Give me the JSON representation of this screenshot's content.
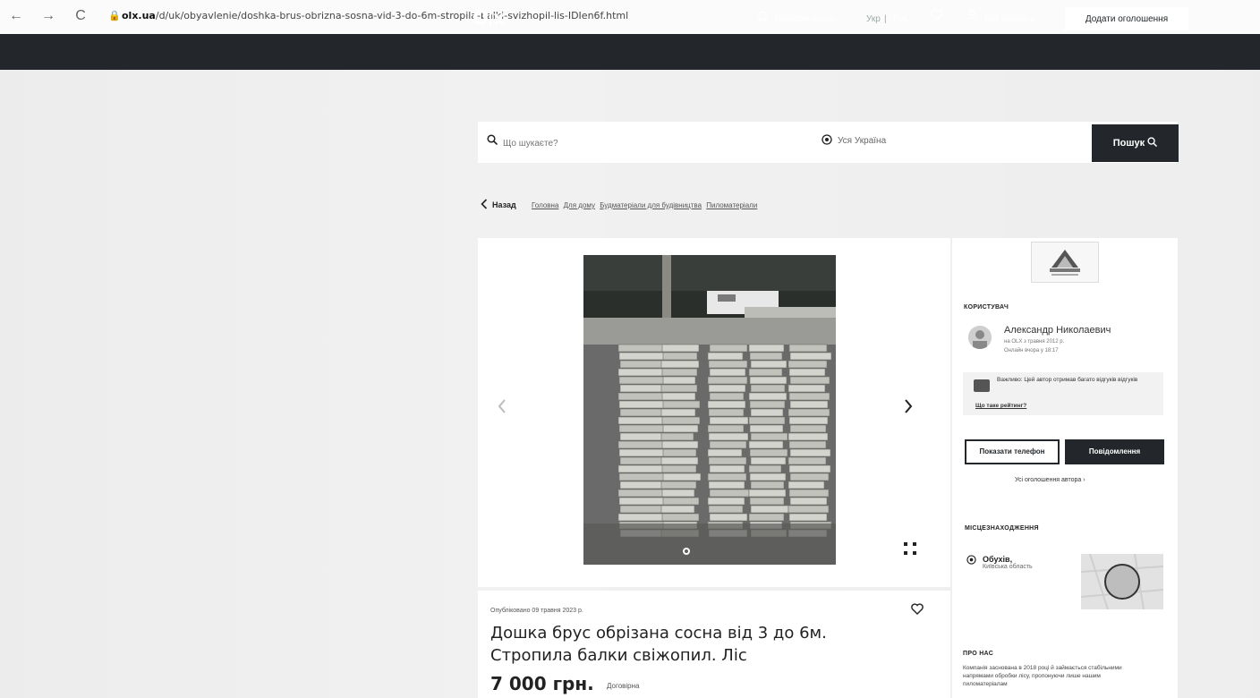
{
  "browser": {
    "back_glyph": "←",
    "forward_glyph": "→",
    "reload_glyph": "C",
    "url_domain": "olx.ua",
    "url_path": "/d/uk/obyavlenie/doshka-brus-obrizna-sosna-vid-3-do-6m-stropila-balki-svizhopil-lis-IDIen6f.html"
  },
  "header": {
    "logo": "olx",
    "messages_label": "Повідомлення",
    "lang_ua": "Укр",
    "lang_ru": "Рус",
    "profile_label": "Мій профіль",
    "add_ad_label": "Додати оголошення"
  },
  "search": {
    "placeholder": "Що шукаєте?",
    "location": "Уся Україна",
    "button_label": "Пошук"
  },
  "breadcrumb": {
    "back_label": "Назад",
    "items": [
      "Головна",
      "Для дому",
      "Будматеріали для будівництва",
      "Пиломатеріали"
    ]
  },
  "listing": {
    "posted": "Опубліковано 09 травня 2023 р.",
    "title": "Дошка брус обрізана сосна від 3 до 6м. Стропила балки свіжопил. Ліс",
    "price": "7 000 грн.",
    "negotiable": "Договірна"
  },
  "seller": {
    "section_label": "КОРИСТУВАЧ",
    "name": "Александр Николаевич",
    "since": "на OLX з травня 2012 р.",
    "online": "Онлайн вчора у 18:17",
    "warning_text": "Важливо: Цей автор отримав багато відгуків відгуків",
    "warning_link": "Що таке рейтинг?",
    "show_phone_label": "Показати телефон",
    "message_label": "Повідомлення",
    "all_ads_label": "Усі оголошення автора"
  },
  "location": {
    "section_label": "МІСЦЕЗНАХОДЖЕННЯ",
    "city": "Обухів,",
    "region": "Київська область"
  },
  "about": {
    "section_label": "ПРО НАС",
    "text": "Компанія заснована в 2018 році й займається стабільними напрямами обробки лісу, пропонуючи лише нашим пиломатеріалам"
  },
  "icons": {
    "search": "magnifier",
    "location": "target",
    "heart": "heart-outline",
    "back": "chevron-left"
  },
  "colors": {
    "header_bg": "#23272b",
    "accent": "#23272b",
    "page_bg": "#f1f1f1"
  }
}
